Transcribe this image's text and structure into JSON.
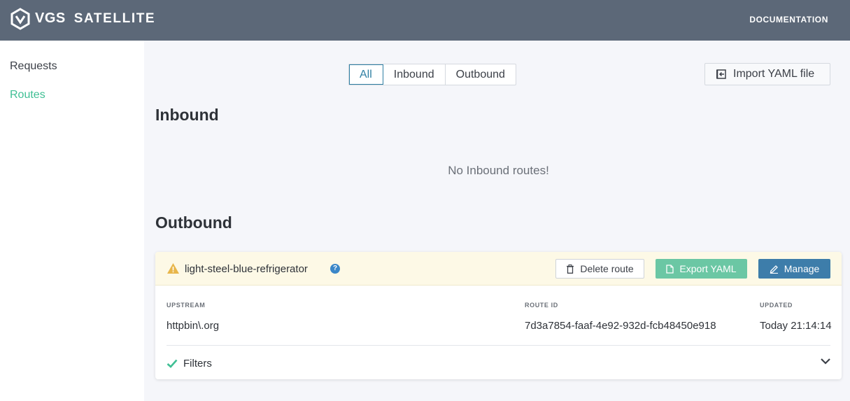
{
  "header": {
    "brand": "VGS",
    "product": "SATELLITE",
    "doc_link": "DOCUMENTATION"
  },
  "sidebar": {
    "items": [
      {
        "label": "Requests",
        "active": false
      },
      {
        "label": "Routes",
        "active": true
      }
    ]
  },
  "filter_tabs": {
    "options": [
      "All",
      "Inbound",
      "Outbound"
    ],
    "selected": "All"
  },
  "import_button": {
    "label": "Import YAML file"
  },
  "inbound": {
    "title": "Inbound",
    "empty_message": "No Inbound routes!"
  },
  "outbound": {
    "title": "Outbound",
    "route": {
      "name": "light-steel-blue-refrigerator",
      "delete_label": "Delete route",
      "export_label": "Export YAML",
      "manage_label": "Manage",
      "upstream_label": "UPSTREAM",
      "upstream_value": "httpbin\\.org",
      "route_id_label": "ROUTE ID",
      "route_id_value": "7d3a7854-faaf-4e92-932d-fcb48450e918",
      "updated_label": "UPDATED",
      "updated_value": "Today 21:14:14",
      "filters_label": "Filters"
    }
  },
  "colors": {
    "topbar": "#5c6878",
    "accent_green": "#3fbf94",
    "export_green": "#6bc7a4",
    "manage_blue": "#3d7daa",
    "warning_bg": "#fdf9e6",
    "warning_icon": "#e8b64a"
  },
  "icons": [
    "vgs-logo-icon",
    "import-icon",
    "warning-icon",
    "help-icon",
    "trash-icon",
    "file-icon",
    "pencil-icon",
    "check-icon",
    "chevron-down-icon"
  ]
}
